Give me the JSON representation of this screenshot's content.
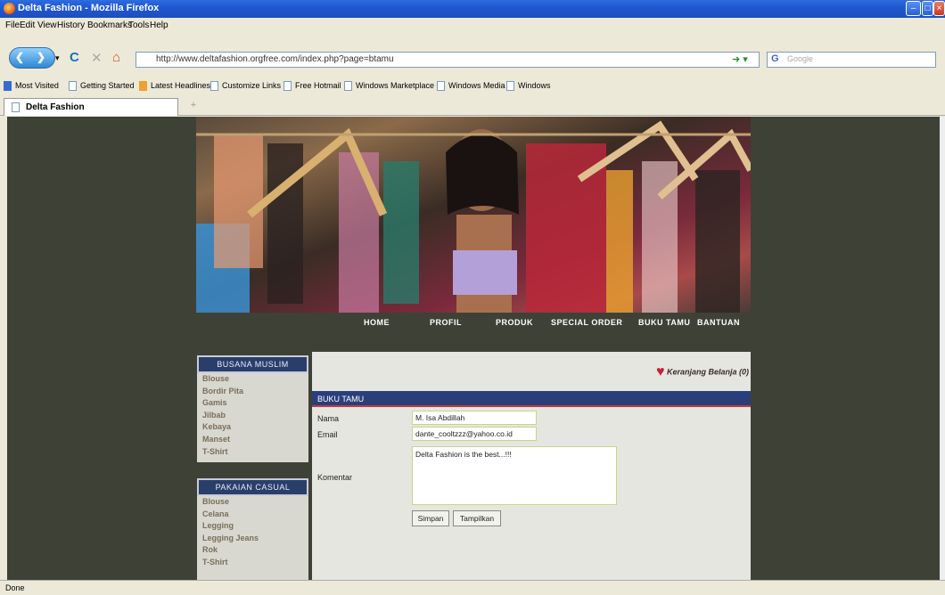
{
  "window": {
    "title": "Delta Fashion - Mozilla Firefox"
  },
  "menu": [
    "File",
    "Edit",
    "View",
    "History",
    "Bookmarks",
    "Tools",
    "Help"
  ],
  "address": {
    "url": "http://www.deltafashion.orgfree.com/index.php?page=btamu"
  },
  "search": {
    "placeholder": "Google"
  },
  "bookmarks": [
    "Most Visited",
    "Getting Started",
    "Latest Headlines",
    "Customize Links",
    "Free Hotmail",
    "Windows Marketplace",
    "Windows Media",
    "Windows"
  ],
  "tab": {
    "label": "Delta Fashion",
    "new": "+"
  },
  "site_nav": [
    "HOME",
    "PROFIL",
    "PRODUK",
    "SPECIAL ORDER",
    "BUKU TAMU",
    "BANTUAN"
  ],
  "sidebar": {
    "muslim": {
      "title": "BUSANA MUSLIM",
      "items": [
        "Blouse",
        "Bordir Pita",
        "Gamis",
        "Jilbab",
        "Kebaya",
        "Manset",
        "T-Shirt"
      ]
    },
    "casual": {
      "title": "PAKAIAN CASUAL",
      "items": [
        "Blouse",
        "Celana",
        "Legging",
        "Legging Jeans",
        "Rok",
        "T-Shirt"
      ]
    }
  },
  "cart": {
    "label": "Keranjang Belanja (0)"
  },
  "form": {
    "title": "BUKU TAMU",
    "nama_label": "Nama",
    "nama_value": "M. Isa Abdillah",
    "email_label": "Email",
    "email_value": "dante_cooltzzz@yahoo.co.id",
    "komentar_label": "Komentar",
    "komentar_value": "Delta Fashion is the best...!!!",
    "save_label": "Simpan",
    "show_label": "Tampilkan"
  },
  "status": {
    "text": "Done"
  }
}
